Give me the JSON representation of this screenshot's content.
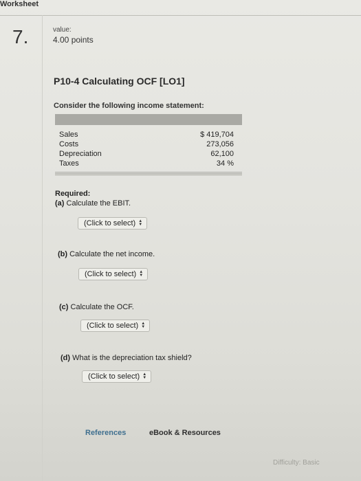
{
  "question": {
    "number": "7.",
    "value_label": "value:",
    "points": "4.00 points",
    "title": "P10-4 Calculating OCF [LO1]",
    "intro": "Consider the following income statement:"
  },
  "income_statement": [
    {
      "label": "Sales",
      "value": "$ 419,704"
    },
    {
      "label": "Costs",
      "value": "273,056"
    },
    {
      "label": "Depreciation",
      "value": "62,100"
    },
    {
      "label": "Taxes",
      "value": "34 %"
    }
  ],
  "required_label": "Required:",
  "parts": [
    {
      "letter": "(a)",
      "text": "Calculate the EBIT.",
      "select": "(Click to select)"
    },
    {
      "letter": "(b)",
      "text": "Calculate the net income.",
      "select": "(Click to select)"
    },
    {
      "letter": "(c)",
      "text": "Calculate the OCF.",
      "select": "(Click to select)"
    },
    {
      "letter": "(d)",
      "text": "What is the depreciation tax shield?",
      "select": "(Click to select)"
    }
  ],
  "footer": {
    "references": "References",
    "ebook": "eBook & Resources",
    "worksheet": "Worksheet",
    "difficulty": "Difficulty: Basic"
  },
  "icons": {
    "select_arrows": "up-down-arrows-icon"
  }
}
